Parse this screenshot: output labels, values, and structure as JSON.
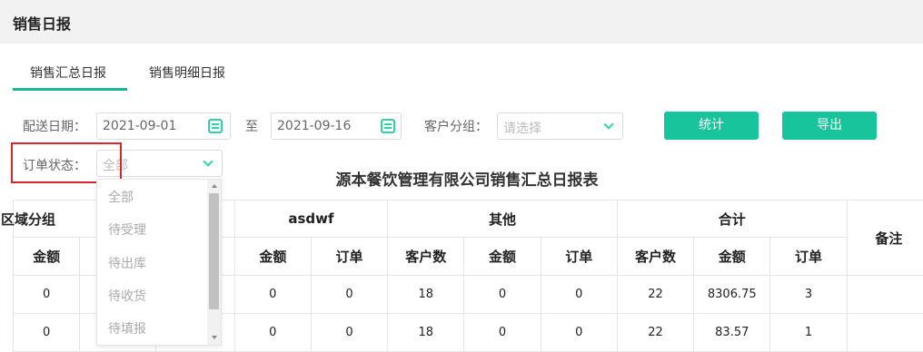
{
  "window": {
    "title": "销售日报"
  },
  "tabs": [
    {
      "label": "销售汇总日报"
    },
    {
      "label": "销售明细日报"
    }
  ],
  "filters": {
    "delivery_date_label": "配送日期：",
    "date_from": "2021-09-01",
    "to_label": "至",
    "date_to": "2021-09-16",
    "customer_group_label": "客户分组：",
    "customer_group_placeholder": "请选择",
    "order_status_label": "订单状态：",
    "order_status_value": "全部",
    "stat_button": "统计",
    "export_button": "导出"
  },
  "dropdown": {
    "options": [
      "全部",
      "待受理",
      "待出库",
      "待收货",
      "待填报"
    ]
  },
  "report": {
    "title": "源本餐饮管理有限公司销售汇总日报表",
    "group_headers": {
      "region": "区域分组",
      "asdwf": "asdwf",
      "other": "其他",
      "total": "合计",
      "remark": "备注"
    },
    "sub_headers": {
      "amount": "金额",
      "orders": "订单",
      "customers": "客户数"
    },
    "rows": [
      {
        "c0": "0",
        "a_amount": "0",
        "a_orders": "0",
        "o_customers": "18",
        "o_amount": "0",
        "o_orders": "0",
        "t_customers": "22",
        "t_amount": "8306.75",
        "t_orders": "3",
        "remark": ""
      },
      {
        "c0": "0",
        "a_amount": "0",
        "a_orders": "0",
        "o_customers": "18",
        "o_amount": "0",
        "o_orders": "0",
        "t_customers": "22",
        "t_amount": "83.57",
        "t_orders": "1",
        "remark": ""
      }
    ]
  },
  "colors": {
    "accent": "#18c49b",
    "highlight": "#d9262c"
  }
}
